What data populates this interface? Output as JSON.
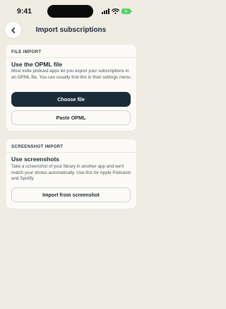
{
  "status_bar": {
    "time": "9:41"
  },
  "header": {
    "title": "Import subscriptions"
  },
  "file_import": {
    "section_label": "FILE IMPORT",
    "heading": "Use the OPML file",
    "description": "Most indie podcast apps let you export your subscriptions in an OPML file. You can usually find this in their settings menu.",
    "choose_file_label": "Choose file",
    "paste_opml_label": "Paste OPML"
  },
  "screenshot_import": {
    "section_label": "SCREENSHOT IMPORT",
    "heading": "Use screenshots",
    "description": "Take a screenshot of your library in another app and we'll match your shows automatically. Use this for Apple Podcasts and Spotify.",
    "import_button_label": "Import from screenshot"
  },
  "colors": {
    "background": "#efece3",
    "card": "#fbfaf6",
    "primary_button": "#1c2b38",
    "text": "#1d2a36",
    "battery": "#4cd964"
  },
  "icons": {
    "back": "chevron-left-icon",
    "signal": "cellular-signal-icon",
    "wifi": "wifi-icon",
    "battery": "battery-charging-icon"
  }
}
